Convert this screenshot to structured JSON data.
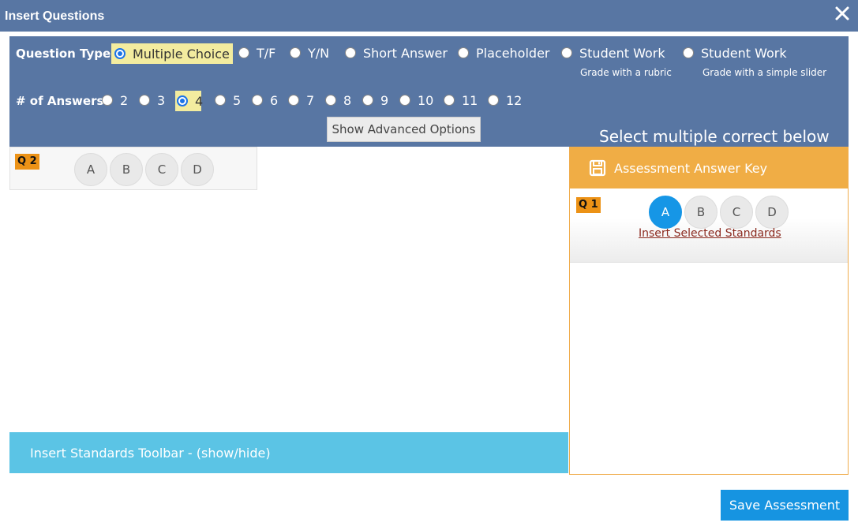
{
  "dialog": {
    "title": "Insert Questions"
  },
  "question_type": {
    "label": "Question Type:",
    "selected": "Multiple Choice",
    "options": [
      {
        "label": "Multiple Choice"
      },
      {
        "label": "T/F"
      },
      {
        "label": "Y/N"
      },
      {
        "label": "Short Answer"
      },
      {
        "label": "Placeholder"
      },
      {
        "label": "Student Work",
        "sub": "Grade with a rubric"
      },
      {
        "label": "Student Work",
        "sub": "Grade with a simple slider"
      }
    ]
  },
  "num_answers": {
    "label": "# of Answers:",
    "selected": "4",
    "options": [
      "2",
      "3",
      "4",
      "5",
      "6",
      "7",
      "8",
      "9",
      "10",
      "11",
      "12"
    ]
  },
  "advanced_button": "Show Advanced Options",
  "select_hint": "Select multiple correct below",
  "question_card": {
    "tag": "Q 2",
    "answers": [
      "A",
      "B",
      "C",
      "D"
    ]
  },
  "standards_toolbar": "Insert Standards Toolbar - (show/hide)",
  "answer_key": {
    "title": "Assessment Answer Key",
    "question": {
      "tag": "Q 1",
      "answers": [
        "A",
        "B",
        "C",
        "D"
      ],
      "selected": "A",
      "link": "Insert Selected Standards"
    }
  },
  "save_button": "Save Assessment",
  "colors": {
    "header_bg": "#5876a3",
    "selected_highlight": "#f3ec9f",
    "question_tag": "#ec9216",
    "answer_key_header": "#f0ad45",
    "standards_bar": "#5bc4e5",
    "primary_button": "#1694e1",
    "selected_answer": "#1696e6"
  },
  "icons": {
    "close": "close-icon",
    "save": "floppy-disk-icon"
  }
}
